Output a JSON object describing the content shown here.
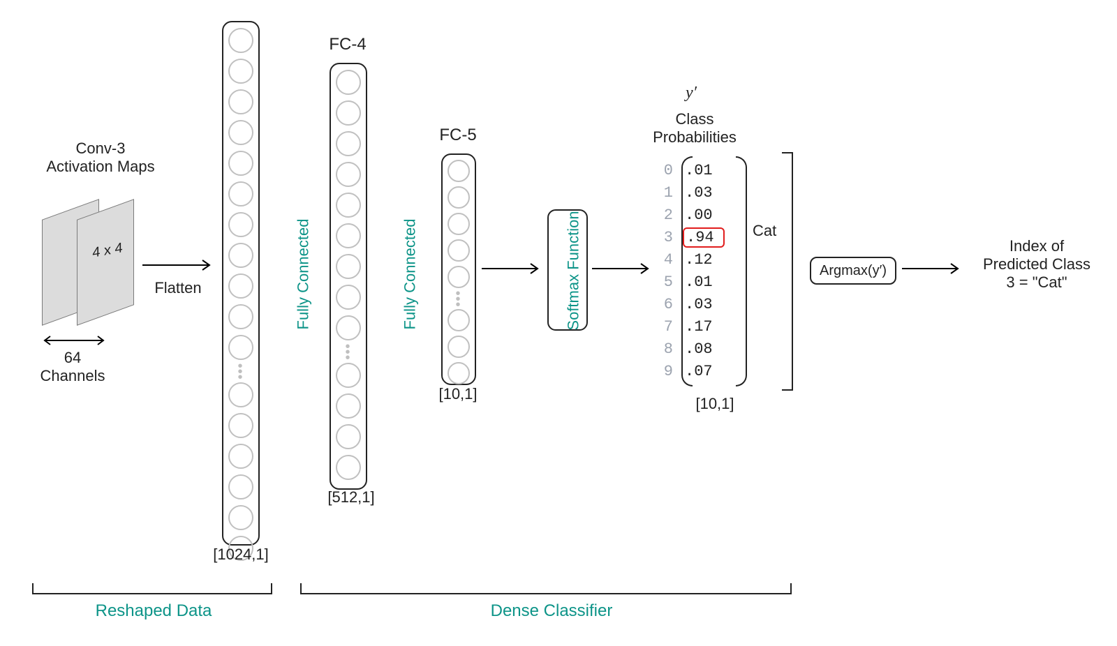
{
  "conv": {
    "title": "Conv-3\nActivation Maps",
    "channels_label": "64\nChannels",
    "map_size_label": "4 x 4"
  },
  "flatten_label": "Flatten",
  "vec1": {
    "shape": "[1024,1]"
  },
  "fc4": {
    "title": "FC-4",
    "shape": "[512,1]"
  },
  "fc5": {
    "title": "FC-5",
    "shape": "[10,1]"
  },
  "fc_label_1": "Fully Connected",
  "fc_label_2": "Fully Connected",
  "softmax_label": "Softmax Function",
  "yprime": "y′",
  "probs": {
    "title": "Class\nProbabilities",
    "indices": [
      "0",
      "1",
      "2",
      "3",
      "4",
      "5",
      "6",
      "7",
      "8",
      "9"
    ],
    "values": [
      ".01",
      ".03",
      ".00",
      ".94",
      ".12",
      ".01",
      ".03",
      ".17",
      ".08",
      ".07"
    ],
    "highlight_index": 3,
    "highlight_label": "Cat",
    "shape": "[10,1]"
  },
  "argmax_label": "Argmax(y′)",
  "output_label": "Index of\nPredicted Class\n3 = \"Cat\"",
  "regions": {
    "left": "Reshaped Data",
    "right": "Dense Classifier"
  }
}
